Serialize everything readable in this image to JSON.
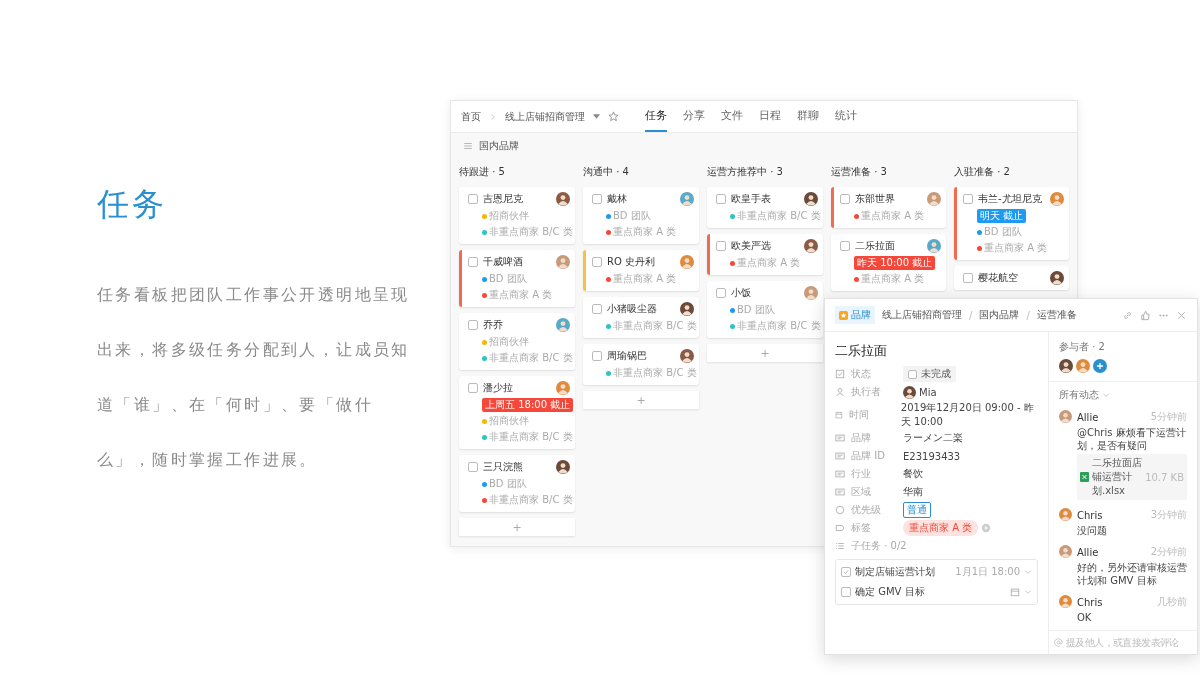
{
  "hero": {
    "title": "任务",
    "description": "任务看板把团队工作事公开透明地呈现出来，将多级任务分配到人，让成员知道「谁」、在「何时」、要「做什么」，随时掌握工作进展。"
  },
  "app": {
    "breadcrumb": {
      "home": "首页",
      "project": "线上店铺招商管理",
      "starred": false
    },
    "tabs": [
      {
        "label": "任务",
        "selected": true
      },
      {
        "label": "分享",
        "selected": false
      },
      {
        "label": "文件",
        "selected": false
      },
      {
        "label": "日程",
        "selected": false
      },
      {
        "label": "群聊",
        "selected": false
      },
      {
        "label": "统计",
        "selected": false
      }
    ],
    "group": "国内品牌",
    "columns": [
      {
        "title": "待跟进 · 5",
        "add": "+",
        "cards": [
          {
            "title": "吉恩尼克",
            "checked": false,
            "tags": [
              {
                "label": "招商伙伴",
                "color": "#f7b500"
              },
              {
                "label": "非重点商家 B/C 类",
                "color": "#2bc4c4"
              }
            ]
          },
          {
            "title": "千威啤酒",
            "checked": false,
            "color": "#f26b4f",
            "tags": [
              {
                "label": "BD 团队",
                "color": "#1e9bf0"
              },
              {
                "label": "重点商家 A 类",
                "color": "#f5483b"
              }
            ]
          },
          {
            "title": "乔乔",
            "checked": false,
            "tags": [
              {
                "label": "招商伙伴",
                "color": "#f7b500"
              },
              {
                "label": "非重点商家 B/C 类",
                "color": "#2bc4c4"
              }
            ]
          },
          {
            "title": "潘少拉",
            "checked": false,
            "deadline": {
              "text": "上周五 18:00 截止",
              "color": "#f5483b"
            },
            "tags": [
              {
                "label": "招商伙伴",
                "color": "#f7b500"
              },
              {
                "label": "非重点商家 B/C 类",
                "color": "#2bc4c4"
              }
            ]
          },
          {
            "title": "三只浣熊",
            "checked": false,
            "tags": [
              {
                "label": "BD 团队",
                "color": "#1e9bf0"
              },
              {
                "label": "非重点商家 B/C 类",
                "color": "#f5483b"
              }
            ]
          }
        ]
      },
      {
        "title": "沟通中 · 4",
        "add": "+",
        "cards": [
          {
            "title": "戴林",
            "checked": false,
            "tags": [
              {
                "label": "BD 团队",
                "color": "#1e9bf0"
              },
              {
                "label": "重点商家 A 类",
                "color": "#f5483b"
              }
            ]
          },
          {
            "title": "RO 史丹利",
            "checked": false,
            "color": "#f5c342",
            "tags": [
              {
                "label": "重点商家 A 类",
                "color": "#f5483b"
              }
            ]
          },
          {
            "title": "小猪吸尘器",
            "checked": false,
            "tags": [
              {
                "label": "非重点商家 B/C 类",
                "color": "#2bc4c4"
              }
            ]
          },
          {
            "title": "周瑜锅巴",
            "checked": false,
            "tags": [
              {
                "label": "非重点商家 B/C 类",
                "color": "#2bc4c4"
              }
            ]
          }
        ]
      },
      {
        "title": "运营方推荐中 · 3",
        "add": "+",
        "cards": [
          {
            "title": "欧皇手表",
            "checked": false,
            "tags": [
              {
                "label": "非重点商家 B/C 类",
                "color": "#2bc4c4"
              }
            ]
          },
          {
            "title": "欧美严选",
            "checked": false,
            "color": "#f26b4f",
            "tags": [
              {
                "label": "重点商家 A 类",
                "color": "#f5483b"
              }
            ]
          },
          {
            "title": "小饭",
            "checked": false,
            "tags": [
              {
                "label": "BD 团队",
                "color": "#1e9bf0"
              },
              {
                "label": "非重点商家 B/C 类",
                "color": "#2bc4c4"
              }
            ]
          }
        ]
      },
      {
        "title": "运营准备 · 3",
        "cards": [
          {
            "title": "东部世界",
            "checked": false,
            "color": "#f26b4f",
            "tags": [
              {
                "label": "重点商家 A 类",
                "color": "#f5483b"
              }
            ]
          },
          {
            "title": "二乐拉面",
            "checked": false,
            "deadline": {
              "text": "昨天 10:00 截止",
              "color": "#f5483b"
            },
            "tags": [
              {
                "label": "重点商家 A 类",
                "color": "#f5483b"
              }
            ]
          }
        ]
      },
      {
        "title": "入驻准备 · 2",
        "cards": [
          {
            "title": "韦兰-尤坦尼克",
            "checked": false,
            "color": "#f26b4f",
            "deadline": {
              "text": "明天 截止",
              "color": "#1e9bf0"
            },
            "tags": [
              {
                "label": "BD 团队",
                "color": "#1e9bf0"
              },
              {
                "label": "重点商家 A 类",
                "color": "#f5483b"
              }
            ]
          },
          {
            "title": "樱花航空",
            "checked": false
          }
        ]
      }
    ]
  },
  "detail": {
    "category": "品牌",
    "path": [
      "线上店铺招商管理",
      "国内品牌",
      "运营准备"
    ],
    "path_separator": "/",
    "title": "二乐拉面",
    "fields": [
      {
        "kind": "status",
        "label": "状态",
        "value": "未完成",
        "checked": false
      },
      {
        "kind": "person",
        "label": "执行者",
        "value": "Mia"
      },
      {
        "kind": "date",
        "label": "时间",
        "value": "2019年12月20日 09:00 - 昨天 10:00"
      },
      {
        "kind": "text",
        "label": "品牌",
        "value": "ラーメン二楽"
      },
      {
        "kind": "text",
        "label": "品牌 ID",
        "value": "E23193433"
      },
      {
        "kind": "text",
        "label": "行业",
        "value": "餐饮"
      },
      {
        "kind": "text",
        "label": "区域",
        "value": "华南"
      },
      {
        "kind": "priority",
        "label": "优先级",
        "value": "普通"
      },
      {
        "kind": "tag",
        "label": "标签",
        "value": "重点商家 A 类"
      }
    ],
    "subtasks_label": "子任务 · 0/2",
    "subtasks": [
      {
        "title": "制定店铺运营计划",
        "checked": true,
        "due": "1月1日 18:00"
      },
      {
        "title": "确定 GMV 目标",
        "checked": false
      }
    ],
    "participants_label": "参与者 · 2",
    "activity_label": "所有动态",
    "comments": [
      {
        "author": "Allie",
        "time": "5分钟前",
        "text": "@Chris 麻烦看下运营计划，是否有疑问",
        "attachment": {
          "name": "二乐拉面店铺运营计划.xlsx",
          "size": "10.7 KB"
        }
      },
      {
        "author": "Chris",
        "time": "3分钟前",
        "text": "没问题"
      },
      {
        "author": "Allie",
        "time": "2分钟前",
        "text": "好的，另外还请审核运营计划和 GMV 目标"
      },
      {
        "author": "Chris",
        "time": "几秒前",
        "text": "OK"
      }
    ],
    "comment_placeholder": "提及他人，或直接发表评论"
  }
}
